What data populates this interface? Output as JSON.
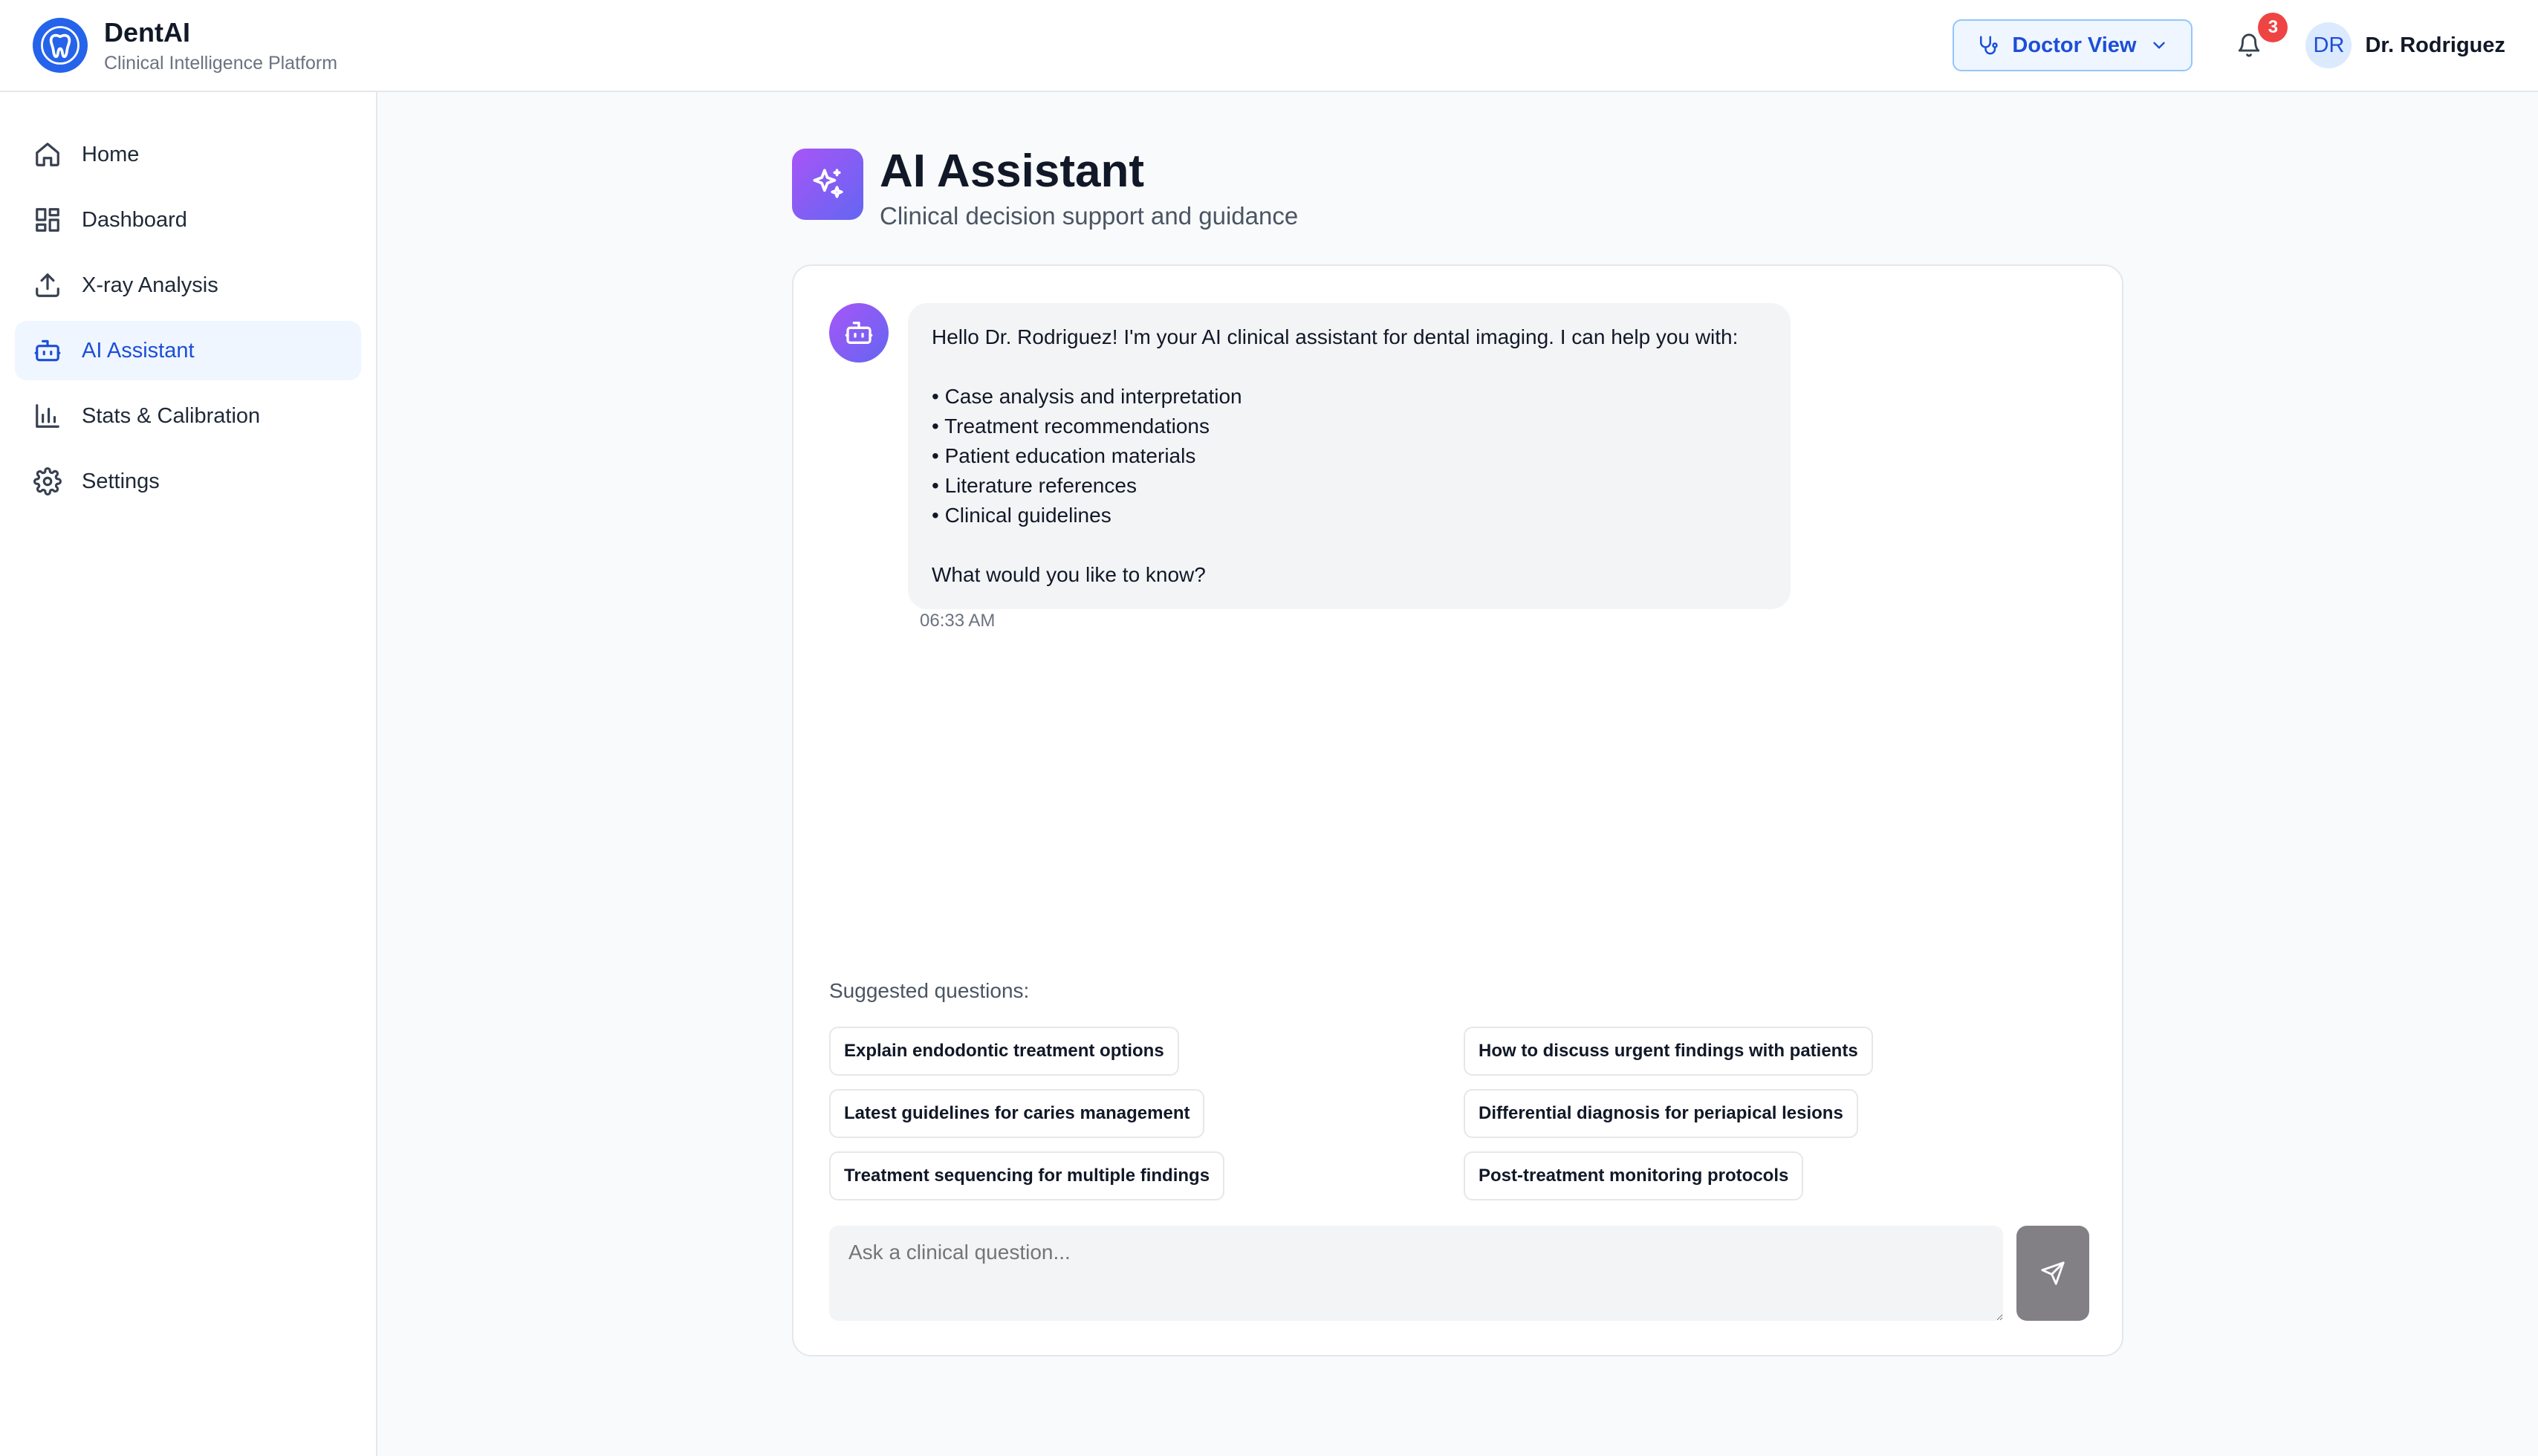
{
  "app": {
    "name": "DentAI",
    "subtitle": "Clinical Intelligence Platform"
  },
  "header": {
    "view_label": "Doctor View",
    "notification_count": "3",
    "user_initials": "DR",
    "user_name": "Dr. Rodriguez"
  },
  "sidebar": {
    "items": [
      {
        "label": "Home",
        "icon": "home-icon"
      },
      {
        "label": "Dashboard",
        "icon": "dashboard-grid-icon"
      },
      {
        "label": "X-ray Analysis",
        "icon": "upload-icon"
      },
      {
        "label": "AI Assistant",
        "icon": "bot-icon",
        "active": true
      },
      {
        "label": "Stats & Calibration",
        "icon": "bar-chart-icon"
      },
      {
        "label": "Settings",
        "icon": "gear-icon"
      }
    ]
  },
  "page": {
    "title": "AI Assistant",
    "subtitle": "Clinical decision support and guidance"
  },
  "chat": {
    "message": {
      "greeting": "Hello Dr. Rodriguez! I'm your AI clinical assistant for dental imaging. I can help you with:",
      "bullets": [
        "• Case analysis and interpretation",
        "• Treatment recommendations",
        "• Patient education materials",
        "• Literature references",
        "• Clinical guidelines"
      ],
      "closing": "What would you like to know?",
      "time": "06:33 AM"
    },
    "suggested_label": "Suggested questions:",
    "suggestions": [
      "Explain endodontic treatment options",
      "How to discuss urgent findings with patients",
      "Latest guidelines for caries management",
      "Differential diagnosis for periapical lesions",
      "Treatment sequencing for multiple findings",
      "Post-treatment monitoring protocols"
    ],
    "input_placeholder": "Ask a clinical question..."
  },
  "colors": {
    "primary": "#2563eb",
    "active_bg": "#eff6ff",
    "badge": "#ef4444",
    "accent_gradient_start": "#a855f7",
    "accent_gradient_end": "#6366f1",
    "send_button": "#828085"
  }
}
